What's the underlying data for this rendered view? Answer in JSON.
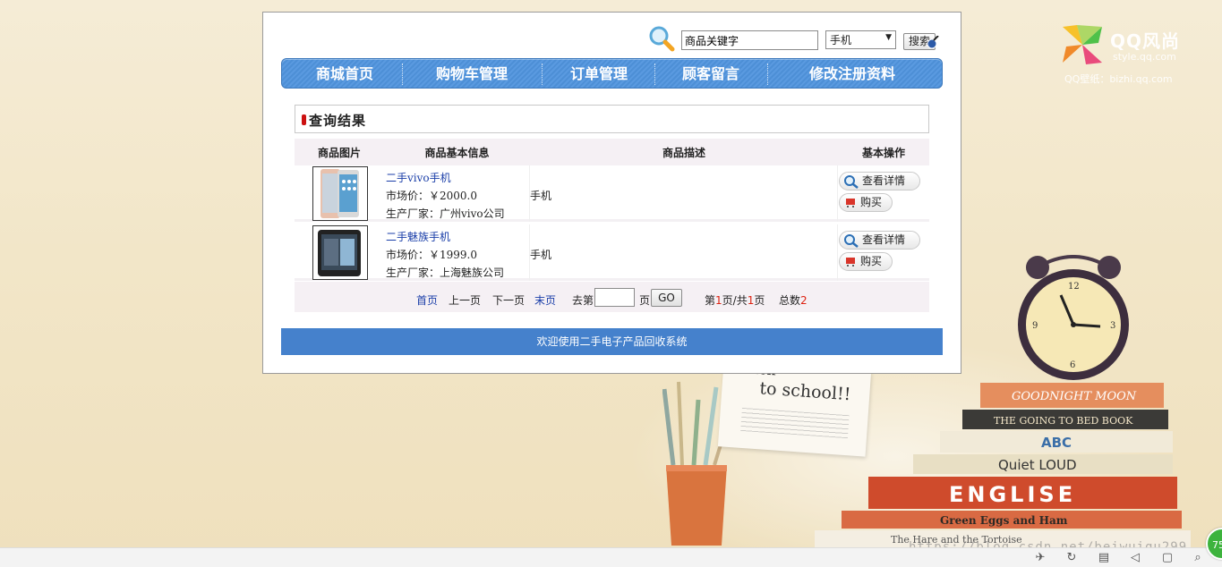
{
  "wallpaper": {
    "logo_text": "QQ风尚",
    "logo_sub": "style.qq.com",
    "logo_sub2": "QQ壁纸：bizhi.qq.com",
    "note_line1": "back",
    "note_line2": "to school!!",
    "watermark": "https://blog.csdn.net/beiwuiqu299",
    "book_titles": [
      "GOODNIGHT MOON",
      "THE GOING TO BED BOOK",
      "ABC",
      "Quiet LOUD",
      "ENGLISE",
      "Green Eggs and Ham",
      "The Hare and the Tortoise"
    ]
  },
  "search": {
    "value": "商品关键字",
    "category_selected": "手机",
    "button_label": "搜索"
  },
  "nav": {
    "items": [
      {
        "label": "商城首页"
      },
      {
        "label": "购物车管理"
      },
      {
        "label": "订单管理"
      },
      {
        "label": "顾客留言"
      },
      {
        "label": "修改注册资料"
      }
    ]
  },
  "results": {
    "title": "查询结果",
    "columns": [
      "商品图片",
      "商品基本信息",
      "商品描述",
      "基本操作"
    ],
    "rows": [
      {
        "name": "二手vivo手机",
        "price": "市场价：￥2000.0",
        "maker": "生产厂家：广州vivo公司",
        "description": "手机",
        "detail_label": "查看详情",
        "buy_label": "购买"
      },
      {
        "name": "二手魅族手机",
        "price": "市场价：￥1999.0",
        "maker": "生产厂家：上海魅族公司",
        "description": "手机",
        "detail_label": "查看详情",
        "buy_label": "购买"
      }
    ]
  },
  "pager": {
    "first": "首页",
    "prev": "上一页",
    "next": "下一页",
    "last": "末页",
    "goto_prefix": "去第",
    "goto_suffix": "页",
    "go_label": "GO",
    "page_info_a": "第",
    "current_page": "1",
    "page_info_b": "页/共",
    "total_pages": "1",
    "page_info_c": "页",
    "total_label": "总数",
    "total_count": "2"
  },
  "footer": {
    "text": "欢迎使用二手电子产品回收系统"
  },
  "taskbar": {
    "badge": "75"
  },
  "colors": {
    "nav_blue": "#4d8fd6",
    "footer_blue": "#4581cc",
    "link_blue": "#1a3ea8",
    "accent_red": "#d21"
  }
}
